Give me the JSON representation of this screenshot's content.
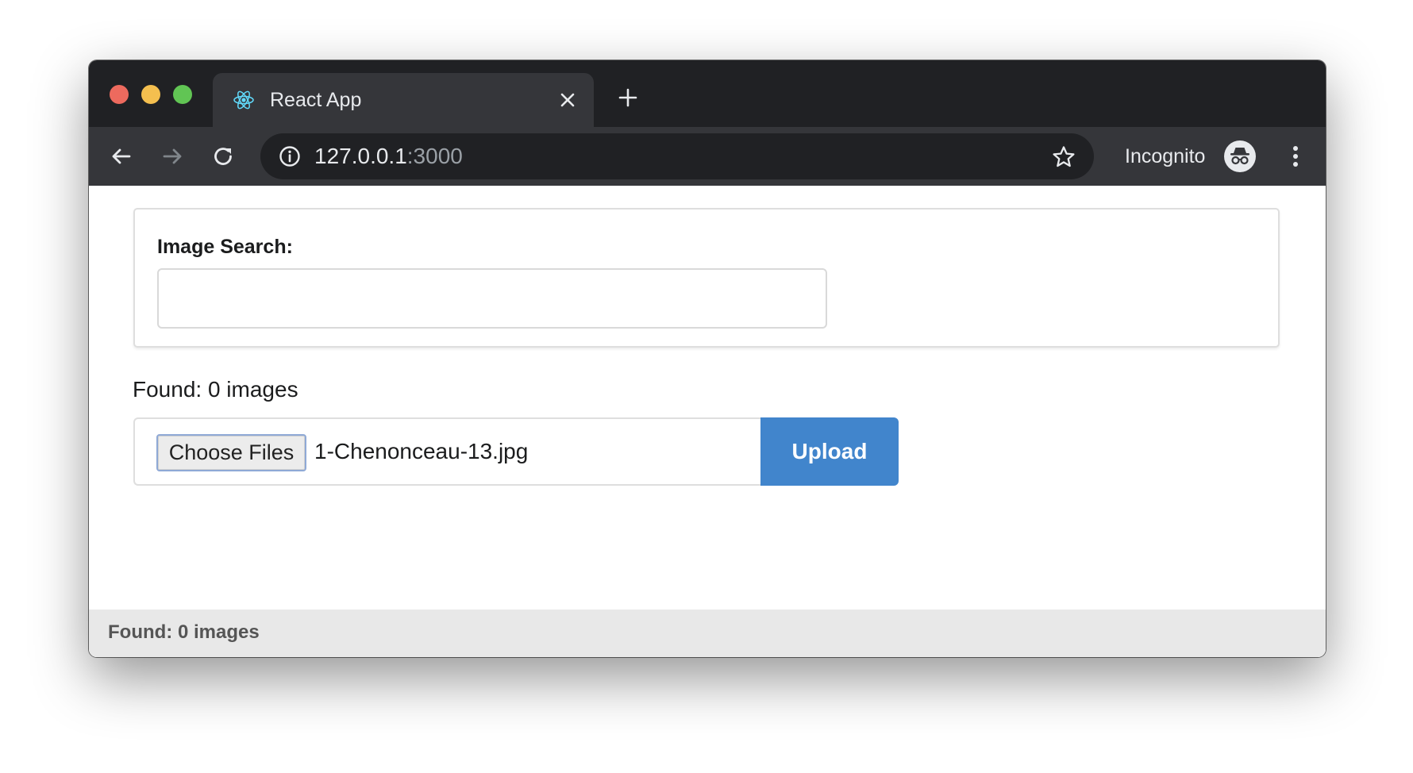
{
  "browser": {
    "tab": {
      "title": "React App",
      "favicon": "react-logo-icon"
    },
    "address": {
      "host": "127.0.0.1",
      "port": ":3000"
    },
    "profile_label": "Incognito",
    "icons": {
      "back": "arrow-left-icon",
      "forward": "arrow-right-icon",
      "reload": "reload-icon",
      "info": "info-icon",
      "bookmark": "star-icon",
      "menu": "more-vertical-icon",
      "close_tab": "close-icon",
      "new_tab": "plus-icon"
    },
    "colors": {
      "frame": "#202124",
      "toolbar": "#35363a"
    }
  },
  "search": {
    "label": "Image Search:",
    "value": "",
    "placeholder": ""
  },
  "results": {
    "found_text": "Found: 0 images"
  },
  "upload": {
    "choose_label": "Choose Files",
    "file_name": "1-Chenonceau-13.jpg",
    "upload_label": "Upload",
    "accent": "#4185cc"
  },
  "footer": {
    "status": "Found: 0 images"
  }
}
